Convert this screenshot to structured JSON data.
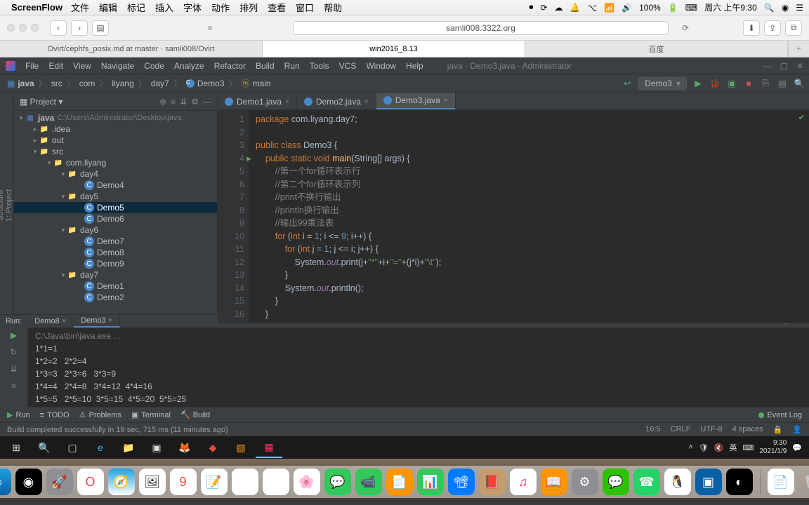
{
  "mac_menu": {
    "app": "ScreenFlow",
    "items": [
      "文件",
      "编辑",
      "标记",
      "插入",
      "字体",
      "动作",
      "排列",
      "查看",
      "窗口",
      "帮助"
    ],
    "right": {
      "battery": "100%",
      "clock": "周六 上午9:30"
    }
  },
  "safari": {
    "address": "samli008.3322.org",
    "tabs": [
      "Ovirt/cephfs_posix.md at master · samli008/Ovirt",
      "win2016_8.13",
      "百度"
    ]
  },
  "ide": {
    "menubar": [
      "File",
      "Edit",
      "View",
      "Navigate",
      "Code",
      "Analyze",
      "Refactor",
      "Build",
      "Run",
      "Tools",
      "VCS",
      "Window",
      "Help"
    ],
    "title": "java - Demo3.java - Administrator",
    "breadcrumbs": [
      "java",
      "src",
      "com",
      "liyang",
      "day7",
      "Demo3",
      "main"
    ],
    "run_config": "Demo3",
    "project_header": "Project",
    "project_root": {
      "name": "java",
      "path": "C:\\Users\\Administrator\\Desktop\\java"
    },
    "tree": {
      "idea": ".idea",
      "out": "out",
      "src": "src",
      "pkg": "com.liyang",
      "day4": "day4",
      "day4_items": [
        "Demo4"
      ],
      "day5": "day5",
      "day5_items": [
        "Demo5",
        "Demo6"
      ],
      "day6": "day6",
      "day6_items": [
        "Demo7",
        "Demo8",
        "Demo9"
      ],
      "day7": "day7",
      "day7_items": [
        "Demo1",
        "Demo2"
      ]
    },
    "editor_tabs": [
      "Demo1.java",
      "Demo2.java",
      "Demo3.java"
    ],
    "code": {
      "l1_pkg": "package",
      "l1_val": "com.liyang.day7;",
      "l3a": "public class",
      "l3b": "Demo3 {",
      "l4a": "public static void",
      "l4b": "main",
      "l4c": "(String[] args) {",
      "l5": "//第一个for循环表示行",
      "l6": "//第二个for循环表示列",
      "l7": "//print不换行输出",
      "l8": "//println换行输出",
      "l9": "//输出99乘法表",
      "l10a": "for",
      "l10b": "(",
      "l10c": "int",
      "l10d": " i = ",
      "l10e": "1",
      "l10f": "; i <= ",
      "l10g": "9",
      "l10h": "; i++) {",
      "l11a": "for",
      "l11b": "(",
      "l11c": "int",
      "l11d": " j = ",
      "l11e": "1",
      "l11f": "; j <= i; j++) {",
      "l12a": "System.",
      "l12b": "out",
      "l12c": ".print(j+",
      "l12d": "\"*\"",
      "l12e": "+i+",
      "l12f": "\"=\"",
      "l12g": "+(j*i)+",
      "l12h": "\"\\t\"",
      "l12i": ");",
      "l13": "}",
      "l14a": "System.",
      "l14b": "out",
      "l14c": ".println();",
      "l15": "}",
      "l16": "}"
    },
    "line_numbers": [
      "1",
      "2",
      "3",
      "4",
      "5",
      "6",
      "7",
      "8",
      "9",
      "10",
      "11",
      "12",
      "13",
      "14",
      "15",
      "16"
    ],
    "run_tabs_label": "Run:",
    "run_tabs": [
      "Demo8",
      "Demo3"
    ],
    "run_output": {
      "cmd": "C:\\Java\\bin\\java.exe ...",
      "rows": [
        "1*1=1",
        "1*2=2   2*2=4",
        "1*3=3   2*3=6   3*3=9",
        "1*4=4   2*4=8   3*4=12  4*4=16",
        "1*5=5   2*5=10  3*5=15  4*5=20  5*5=25"
      ]
    },
    "bottom_tabs": {
      "run": "Run",
      "todo": "TODO",
      "problems": "Problems",
      "terminal": "Terminal",
      "build": "Build",
      "event": "Event Log"
    },
    "status": {
      "msg": "Build completed successfully in 19 sec, 715 ms (11 minutes ago)",
      "pos": "16:5",
      "eol": "CRLF",
      "enc": "UTF-8",
      "indent": "4 spaces"
    }
  },
  "windows_taskbar": {
    "lang": "英",
    "time": "9:30",
    "date": "2021/1/9"
  }
}
